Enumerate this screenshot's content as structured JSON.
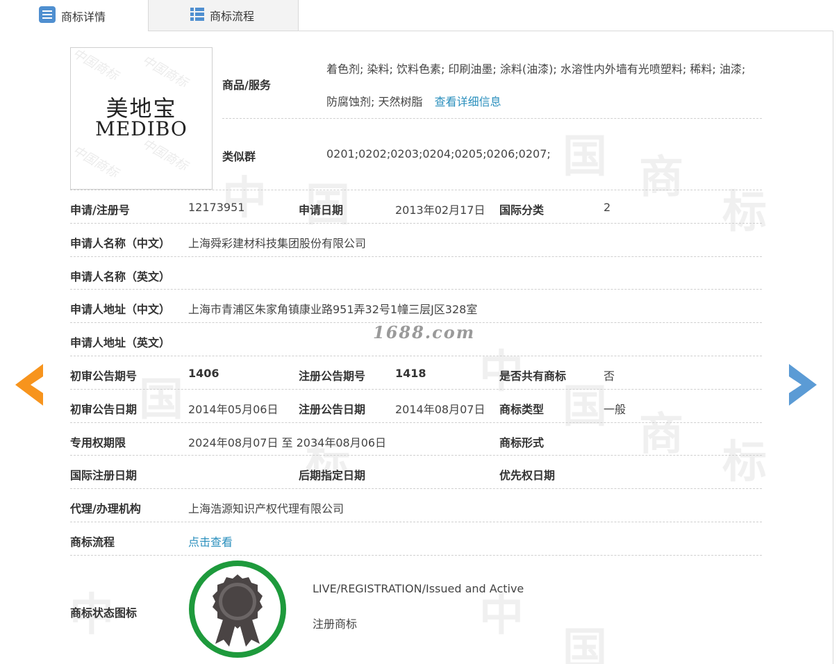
{
  "tabs": [
    {
      "label": "商标详情"
    },
    {
      "label": "商标流程"
    }
  ],
  "logo": {
    "cn": "美地宝",
    "en": "MEDIBO",
    "watermark": "中国商标"
  },
  "goods": {
    "label": "商品/服务",
    "line1": "着色剂; 染料; 饮料色素; 印刷油墨; 涂料(油漆); 水溶性内外墙有光喷塑料; 稀料; 油漆;",
    "line2": "防腐蚀剂; 天然树脂",
    "more_link": "查看详细信息"
  },
  "similar_group": {
    "label": "类似群",
    "value": "0201;0202;0203;0204;0205;0206;0207;"
  },
  "fields": {
    "reg_no": {
      "label": "申请/注册号",
      "value": "12173951"
    },
    "apply_date": {
      "label": "申请日期",
      "value": "2013年02月17日"
    },
    "intl_class": {
      "label": "国际分类",
      "value": "2"
    },
    "applicant_cn": {
      "label": "申请人名称（中文）",
      "value": "上海舜彩建材科技集团股份有限公司"
    },
    "applicant_en": {
      "label": "申请人名称（英文）",
      "value": ""
    },
    "address_cn": {
      "label": "申请人地址（中文）",
      "value": "上海市青浦区朱家角镇康业路951弄32号1幢三层J区328室"
    },
    "address_en": {
      "label": "申请人地址（英文）",
      "value": ""
    },
    "prelim_issue": {
      "label": "初审公告期号",
      "value": "1406"
    },
    "reg_issue": {
      "label": "注册公告期号",
      "value": "1418"
    },
    "shared": {
      "label": "是否共有商标",
      "value": "否"
    },
    "prelim_date": {
      "label": "初审公告日期",
      "value": "2014年05月06日"
    },
    "reg_date": {
      "label": "注册公告日期",
      "value": "2014年08月07日"
    },
    "tm_type": {
      "label": "商标类型",
      "value": "一般"
    },
    "term": {
      "label": "专用权期限",
      "value": "2024年08月07日 至 2034年08月06日"
    },
    "tm_form": {
      "label": "商标形式",
      "value": ""
    },
    "intl_reg_date": {
      "label": "国际注册日期",
      "value": ""
    },
    "later_date": {
      "label": "后期指定日期",
      "value": ""
    },
    "priority_date": {
      "label": "优先权日期",
      "value": ""
    },
    "agent": {
      "label": "代理/办理机构",
      "value": "上海浩源知识产权代理有限公司"
    },
    "flow": {
      "label": "商标流程",
      "link": "点击查看"
    }
  },
  "status": {
    "label": "商标状态图标",
    "en": "LIVE/REGISTRATION/Issued and Active",
    "cn": "注册商标"
  },
  "site_watermark": "1688.com",
  "colors": {
    "link": "#2a8fbd",
    "prev_arrow": "#f7941d",
    "next_arrow": "#5b9bd5",
    "badge_ring": "#1e9a3c"
  }
}
